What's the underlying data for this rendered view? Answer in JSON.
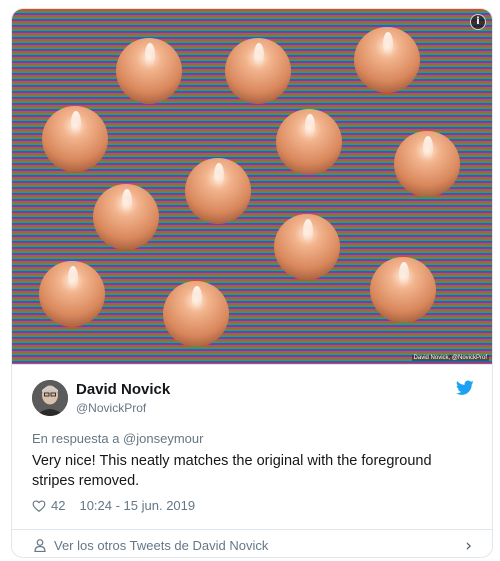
{
  "media": {
    "credit": "David Novick, @NovickProf",
    "stripe_colors": [
      "#e8422e",
      "#2aa64a",
      "#3f4fe0"
    ],
    "sphere_color": "#e0966a"
  },
  "tweet": {
    "author_name": "David Novick",
    "author_handle": "@NovickProf",
    "reply_to": "En respuesta a @jonseymour",
    "text": "Very nice! This neatly matches the original with the foreground stripes removed.",
    "likes": "42",
    "timestamp": "10:24 - 15 jun. 2019",
    "more_tweets_link": "Ver los otros Tweets de David Novick",
    "accent_color": "#1da1f2"
  }
}
